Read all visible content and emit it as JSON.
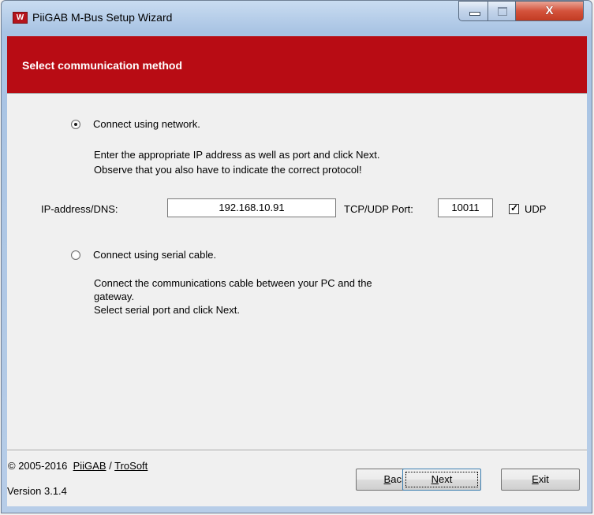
{
  "window": {
    "title": "PiiGAB M-Bus Setup Wizard",
    "icon_letter": "W",
    "close_glyph": "X"
  },
  "banner": {
    "title": "Select communication method",
    "color": "#b80c14"
  },
  "network_option": {
    "label": "Connect using network.",
    "selected": true,
    "desc_line1": "Enter the appropriate IP address as well as port and click Next.",
    "desc_line2": "Observe that you also have to indicate the correct protocol!"
  },
  "ip_field": {
    "label": "IP-address/DNS:",
    "value": "192.168.10.91"
  },
  "port_field": {
    "label": "TCP/UDP Port:",
    "value": "10011"
  },
  "udp_checkbox": {
    "label": "UDP",
    "checked": true
  },
  "serial_option": {
    "label": "Connect using serial cable.",
    "selected": false,
    "desc_line1": "Connect the communications cable between your PC and the",
    "desc_line2": "gateway.",
    "desc_line3": "Select serial port and click Next."
  },
  "footer": {
    "copyright_prefix": "© 2005-2016",
    "link_piigab": "PiiGAB",
    "separator": "/",
    "link_trosoft": "TroSoft",
    "version": "Version 3.1.4"
  },
  "buttons": {
    "back_mnemonic": "B",
    "back_rest": "ack",
    "next_mnemonic": "N",
    "next_rest": "ext",
    "exit_mnemonic": "E",
    "exit_rest": "xit"
  }
}
